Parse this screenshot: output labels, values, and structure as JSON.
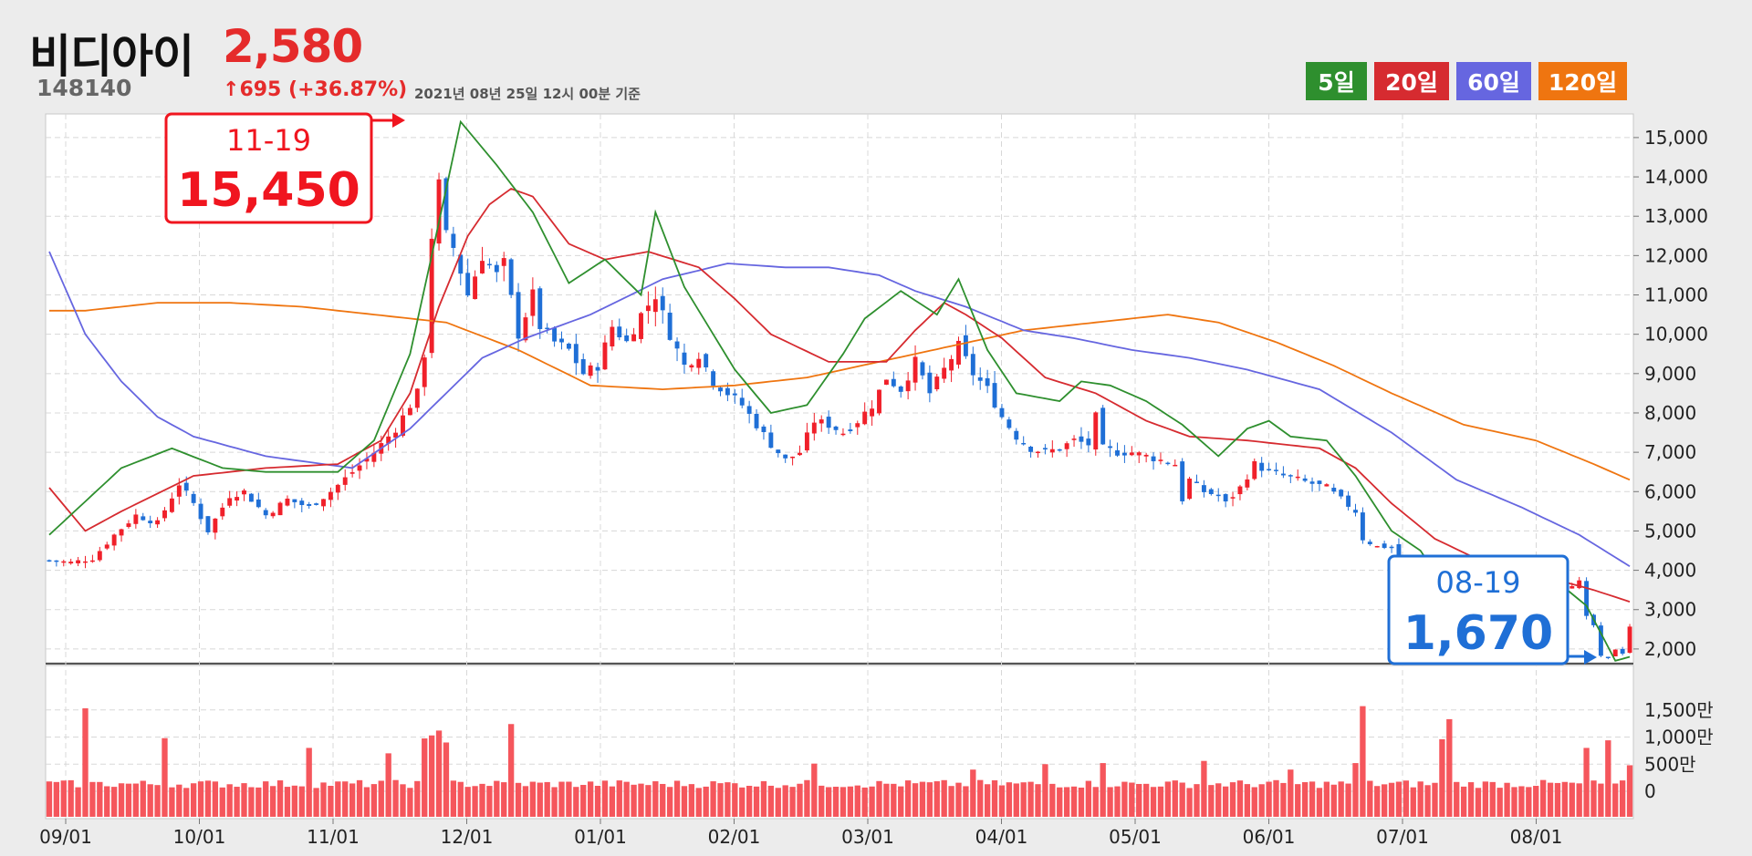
{
  "header": {
    "name": "비디아이",
    "price": "2,580",
    "code": "148140",
    "change": "695 (+36.87%)",
    "timestamp": "2021년 08년 25일 12시 00분 기준"
  },
  "legend": [
    {
      "label": "5일",
      "color": "#2e8f2e"
    },
    {
      "label": "20일",
      "color": "#d62b30"
    },
    {
      "label": "60일",
      "color": "#6666e0"
    },
    {
      "label": "120일",
      "color": "#ef7510"
    }
  ],
  "colors": {
    "up": "#f0202a",
    "down": "#1f6fd6",
    "volume": "#f5565c",
    "grid": "#d8d8d8"
  },
  "callouts": {
    "high": {
      "date": "11-19",
      "value": "15,450",
      "color": "#f0151f"
    },
    "low": {
      "date": "08-19",
      "value": "1,670",
      "color": "#1f6fd6"
    }
  },
  "chart_data": {
    "type": "candlestick",
    "x_labels": [
      "09/01",
      "10/01",
      "11/01",
      "12/01",
      "01/01",
      "02/01",
      "03/01",
      "04/01",
      "05/01",
      "06/01",
      "07/01",
      "08/01"
    ],
    "price_axis": {
      "ticks": [
        "2,000",
        "3,000",
        "4,000",
        "5,000",
        "6,000",
        "7,000",
        "8,000",
        "9,000",
        "10,000",
        "11,000",
        "12,000",
        "13,000",
        "14,000",
        "15,000"
      ],
      "min": 1650,
      "max": 15600
    },
    "volume_axis": {
      "ticks": [
        "0",
        "500만",
        "1,000만",
        "1,500만"
      ],
      "max": 1900
    },
    "price_anchors": [
      [
        0,
        4250
      ],
      [
        3,
        4200
      ],
      [
        6,
        4300
      ],
      [
        9,
        4900
      ],
      [
        12,
        5400
      ],
      [
        15,
        5200
      ],
      [
        18,
        6200
      ],
      [
        20,
        5700
      ],
      [
        22,
        5000
      ],
      [
        25,
        5900
      ],
      [
        27,
        6000
      ],
      [
        30,
        5400
      ],
      [
        33,
        5800
      ],
      [
        36,
        5600
      ],
      [
        39,
        6000
      ],
      [
        42,
        6500
      ],
      [
        45,
        7000
      ],
      [
        48,
        7600
      ],
      [
        51,
        8500
      ],
      [
        52,
        9500
      ],
      [
        53,
        12500
      ],
      [
        54,
        13800
      ],
      [
        55,
        12500
      ],
      [
        56,
        12200
      ],
      [
        58,
        11000
      ],
      [
        60,
        12000
      ],
      [
        62,
        11500
      ],
      [
        63,
        11800
      ],
      [
        65,
        10000
      ],
      [
        67,
        11000
      ],
      [
        68,
        10200
      ],
      [
        70,
        9800
      ],
      [
        72,
        9600
      ],
      [
        74,
        9000
      ],
      [
        76,
        9200
      ],
      [
        78,
        10200
      ],
      [
        80,
        9800
      ],
      [
        82,
        10500
      ],
      [
        84,
        11000
      ],
      [
        86,
        10000
      ],
      [
        88,
        9200
      ],
      [
        90,
        9500
      ],
      [
        92,
        8800
      ],
      [
        94,
        8500
      ],
      [
        96,
        8200
      ],
      [
        98,
        7700
      ],
      [
        100,
        7200
      ],
      [
        102,
        6800
      ],
      [
        104,
        7000
      ],
      [
        106,
        7800
      ],
      [
        108,
        7700
      ],
      [
        110,
        7500
      ],
      [
        112,
        7800
      ],
      [
        114,
        8200
      ],
      [
        116,
        8900
      ],
      [
        118,
        8600
      ],
      [
        120,
        9300
      ],
      [
        122,
        8500
      ],
      [
        124,
        9100
      ],
      [
        126,
        9700
      ],
      [
        128,
        9000
      ],
      [
        130,
        8600
      ],
      [
        132,
        7900
      ],
      [
        134,
        7400
      ],
      [
        136,
        7100
      ],
      [
        138,
        7000
      ],
      [
        140,
        7100
      ],
      [
        142,
        7300
      ],
      [
        144,
        7200
      ],
      [
        145,
        7900
      ],
      [
        146,
        7100
      ],
      [
        148,
        7000
      ],
      [
        150,
        7000
      ],
      [
        152,
        6900
      ],
      [
        154,
        6800
      ],
      [
        156,
        6700
      ],
      [
        157,
        5800
      ],
      [
        158,
        6300
      ],
      [
        160,
        6000
      ],
      [
        162,
        5900
      ],
      [
        163,
        5700
      ],
      [
        165,
        6100
      ],
      [
        167,
        6700
      ],
      [
        169,
        6500
      ],
      [
        171,
        6400
      ],
      [
        173,
        6300
      ],
      [
        175,
        6200
      ],
      [
        177,
        6100
      ],
      [
        179,
        5800
      ],
      [
        181,
        5500
      ],
      [
        182,
        4800
      ],
      [
        184,
        4600
      ],
      [
        186,
        4600
      ],
      [
        188,
        4000
      ],
      [
        190,
        3500
      ],
      [
        192,
        3200
      ],
      [
        194,
        3300
      ],
      [
        196,
        3300
      ],
      [
        198,
        3400
      ],
      [
        200,
        3300
      ],
      [
        202,
        3400
      ],
      [
        204,
        3500
      ],
      [
        206,
        3400
      ],
      [
        208,
        3500
      ],
      [
        210,
        3600
      ],
      [
        212,
        3700
      ],
      [
        213,
        2800
      ],
      [
        214,
        2600
      ],
      [
        215,
        1800
      ],
      [
        216,
        1780
      ],
      [
        217,
        2000
      ],
      [
        218,
        1900
      ],
      [
        219,
        2580
      ]
    ],
    "volume_bars": [
      {
        "i": 5,
        "v": 1530
      },
      {
        "i": 16,
        "v": 980
      },
      {
        "i": 36,
        "v": 800
      },
      {
        "i": 47,
        "v": 700
      },
      {
        "i": 52,
        "v": 975
      },
      {
        "i": 53,
        "v": 1030
      },
      {
        "i": 54,
        "v": 1120
      },
      {
        "i": 55,
        "v": 900
      },
      {
        "i": 64,
        "v": 1240
      },
      {
        "i": 106,
        "v": 510
      },
      {
        "i": 128,
        "v": 400
      },
      {
        "i": 138,
        "v": 500
      },
      {
        "i": 146,
        "v": 520
      },
      {
        "i": 160,
        "v": 560
      },
      {
        "i": 172,
        "v": 400
      },
      {
        "i": 181,
        "v": 520
      },
      {
        "i": 182,
        "v": 1570
      },
      {
        "i": 193,
        "v": 960
      },
      {
        "i": 194,
        "v": 1330
      },
      {
        "i": 213,
        "v": 800
      },
      {
        "i": 216,
        "v": 940
      },
      {
        "i": 219,
        "v": 480
      }
    ],
    "ma5_anchors": [
      [
        0,
        4900
      ],
      [
        10,
        6600
      ],
      [
        17,
        7100
      ],
      [
        24,
        6600
      ],
      [
        30,
        6500
      ],
      [
        40,
        6500
      ],
      [
        45,
        7300
      ],
      [
        50,
        9500
      ],
      [
        53,
        12000
      ],
      [
        57,
        15400
      ],
      [
        62,
        14300
      ],
      [
        67,
        13100
      ],
      [
        72,
        11300
      ],
      [
        77,
        11900
      ],
      [
        82,
        11000
      ],
      [
        84,
        13100
      ],
      [
        88,
        11200
      ],
      [
        95,
        9100
      ],
      [
        100,
        8000
      ],
      [
        105,
        8200
      ],
      [
        110,
        9500
      ],
      [
        113,
        10400
      ],
      [
        118,
        11100
      ],
      [
        123,
        10500
      ],
      [
        126,
        11400
      ],
      [
        130,
        9600
      ],
      [
        134,
        8500
      ],
      [
        140,
        8300
      ],
      [
        143,
        8800
      ],
      [
        147,
        8700
      ],
      [
        152,
        8300
      ],
      [
        157,
        7700
      ],
      [
        162,
        6900
      ],
      [
        166,
        7600
      ],
      [
        169,
        7800
      ],
      [
        172,
        7400
      ],
      [
        177,
        7300
      ],
      [
        181,
        6400
      ],
      [
        186,
        5000
      ],
      [
        190,
        4500
      ],
      [
        194,
        3400
      ],
      [
        200,
        3300
      ],
      [
        205,
        3500
      ],
      [
        209,
        3700
      ],
      [
        213,
        3100
      ],
      [
        217,
        1700
      ],
      [
        219,
        1800
      ]
    ],
    "ma20_anchors": [
      [
        0,
        6100
      ],
      [
        5,
        5000
      ],
      [
        10,
        5500
      ],
      [
        20,
        6400
      ],
      [
        30,
        6600
      ],
      [
        40,
        6700
      ],
      [
        46,
        7300
      ],
      [
        50,
        8500
      ],
      [
        54,
        10700
      ],
      [
        58,
        12500
      ],
      [
        61,
        13300
      ],
      [
        64,
        13700
      ],
      [
        67,
        13500
      ],
      [
        72,
        12300
      ],
      [
        77,
        11900
      ],
      [
        83,
        12100
      ],
      [
        90,
        11700
      ],
      [
        95,
        10900
      ],
      [
        100,
        10000
      ],
      [
        108,
        9300
      ],
      [
        116,
        9300
      ],
      [
        120,
        10100
      ],
      [
        124,
        10800
      ],
      [
        127,
        10500
      ],
      [
        132,
        9900
      ],
      [
        138,
        8900
      ],
      [
        145,
        8500
      ],
      [
        152,
        7800
      ],
      [
        158,
        7400
      ],
      [
        166,
        7300
      ],
      [
        176,
        7100
      ],
      [
        181,
        6600
      ],
      [
        186,
        5700
      ],
      [
        192,
        4800
      ],
      [
        200,
        4100
      ],
      [
        208,
        3800
      ],
      [
        214,
        3500
      ],
      [
        219,
        3200
      ]
    ],
    "ma60_anchors": [
      [
        0,
        12100
      ],
      [
        5,
        10000
      ],
      [
        10,
        8800
      ],
      [
        15,
        7900
      ],
      [
        20,
        7400
      ],
      [
        30,
        6900
      ],
      [
        42,
        6600
      ],
      [
        50,
        7600
      ],
      [
        60,
        9400
      ],
      [
        66,
        9900
      ],
      [
        75,
        10500
      ],
      [
        85,
        11400
      ],
      [
        94,
        11800
      ],
      [
        102,
        11700
      ],
      [
        108,
        11700
      ],
      [
        115,
        11500
      ],
      [
        120,
        11100
      ],
      [
        127,
        10700
      ],
      [
        135,
        10100
      ],
      [
        142,
        9900
      ],
      [
        150,
        9600
      ],
      [
        158,
        9400
      ],
      [
        166,
        9100
      ],
      [
        176,
        8600
      ],
      [
        186,
        7500
      ],
      [
        195,
        6300
      ],
      [
        204,
        5600
      ],
      [
        212,
        4900
      ],
      [
        219,
        4100
      ]
    ],
    "ma120_anchors": [
      [
        0,
        10600
      ],
      [
        5,
        10600
      ],
      [
        15,
        10800
      ],
      [
        25,
        10800
      ],
      [
        35,
        10700
      ],
      [
        45,
        10500
      ],
      [
        55,
        10300
      ],
      [
        65,
        9600
      ],
      [
        75,
        8700
      ],
      [
        85,
        8600
      ],
      [
        95,
        8700
      ],
      [
        105,
        8900
      ],
      [
        115,
        9300
      ],
      [
        125,
        9700
      ],
      [
        135,
        10100
      ],
      [
        145,
        10300
      ],
      [
        155,
        10500
      ],
      [
        162,
        10300
      ],
      [
        170,
        9800
      ],
      [
        178,
        9200
      ],
      [
        186,
        8500
      ],
      [
        196,
        7700
      ],
      [
        206,
        7300
      ],
      [
        214,
        6700
      ],
      [
        219,
        6300
      ]
    ]
  }
}
